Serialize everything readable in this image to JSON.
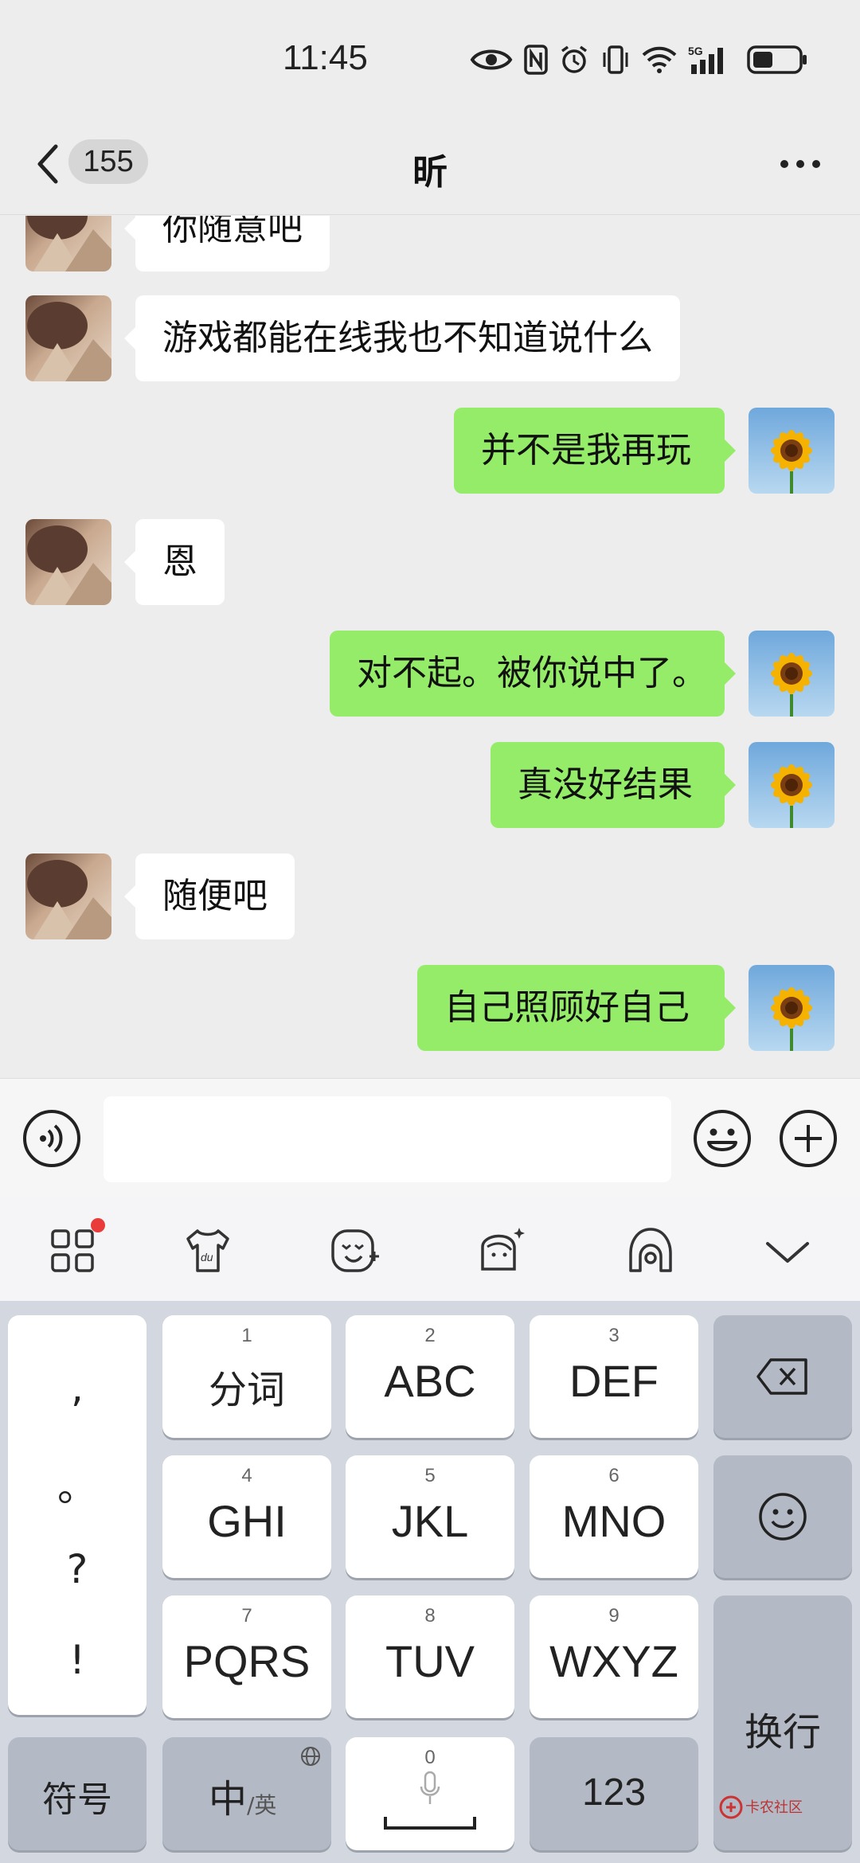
{
  "status_bar": {
    "time": "11:45",
    "network": "5G"
  },
  "nav": {
    "unread_count": "155",
    "title": "昕"
  },
  "messages": [
    {
      "side": "left",
      "text": "你随意吧"
    },
    {
      "side": "left",
      "text": "游戏都能在线我也不知道说什么"
    },
    {
      "side": "right",
      "text": "并不是我再玩"
    },
    {
      "side": "left",
      "text": "恩"
    },
    {
      "side": "right",
      "text": "对不起。被你说中了。"
    },
    {
      "side": "right",
      "text": "真没好结果"
    },
    {
      "side": "left",
      "text": "随便吧"
    },
    {
      "side": "right",
      "text": "自己照顾好自己"
    }
  ],
  "input": {
    "value": ""
  },
  "keyboard": {
    "punct": [
      ",",
      "。",
      "?",
      "!"
    ],
    "keys": [
      {
        "num": "1",
        "label": "分词"
      },
      {
        "num": "2",
        "label": "ABC"
      },
      {
        "num": "3",
        "label": "DEF"
      },
      {
        "num": "4",
        "label": "GHI"
      },
      {
        "num": "5",
        "label": "JKL"
      },
      {
        "num": "6",
        "label": "MNO"
      },
      {
        "num": "7",
        "label": "PQRS"
      },
      {
        "num": "8",
        "label": "TUV"
      },
      {
        "num": "9",
        "label": "WXYZ"
      }
    ],
    "symbols": "符号",
    "lang_main": "中",
    "lang_alt": "/英",
    "space_num": "0",
    "numbers": "123",
    "enter": "换行"
  },
  "watermark": "卡农社区"
}
